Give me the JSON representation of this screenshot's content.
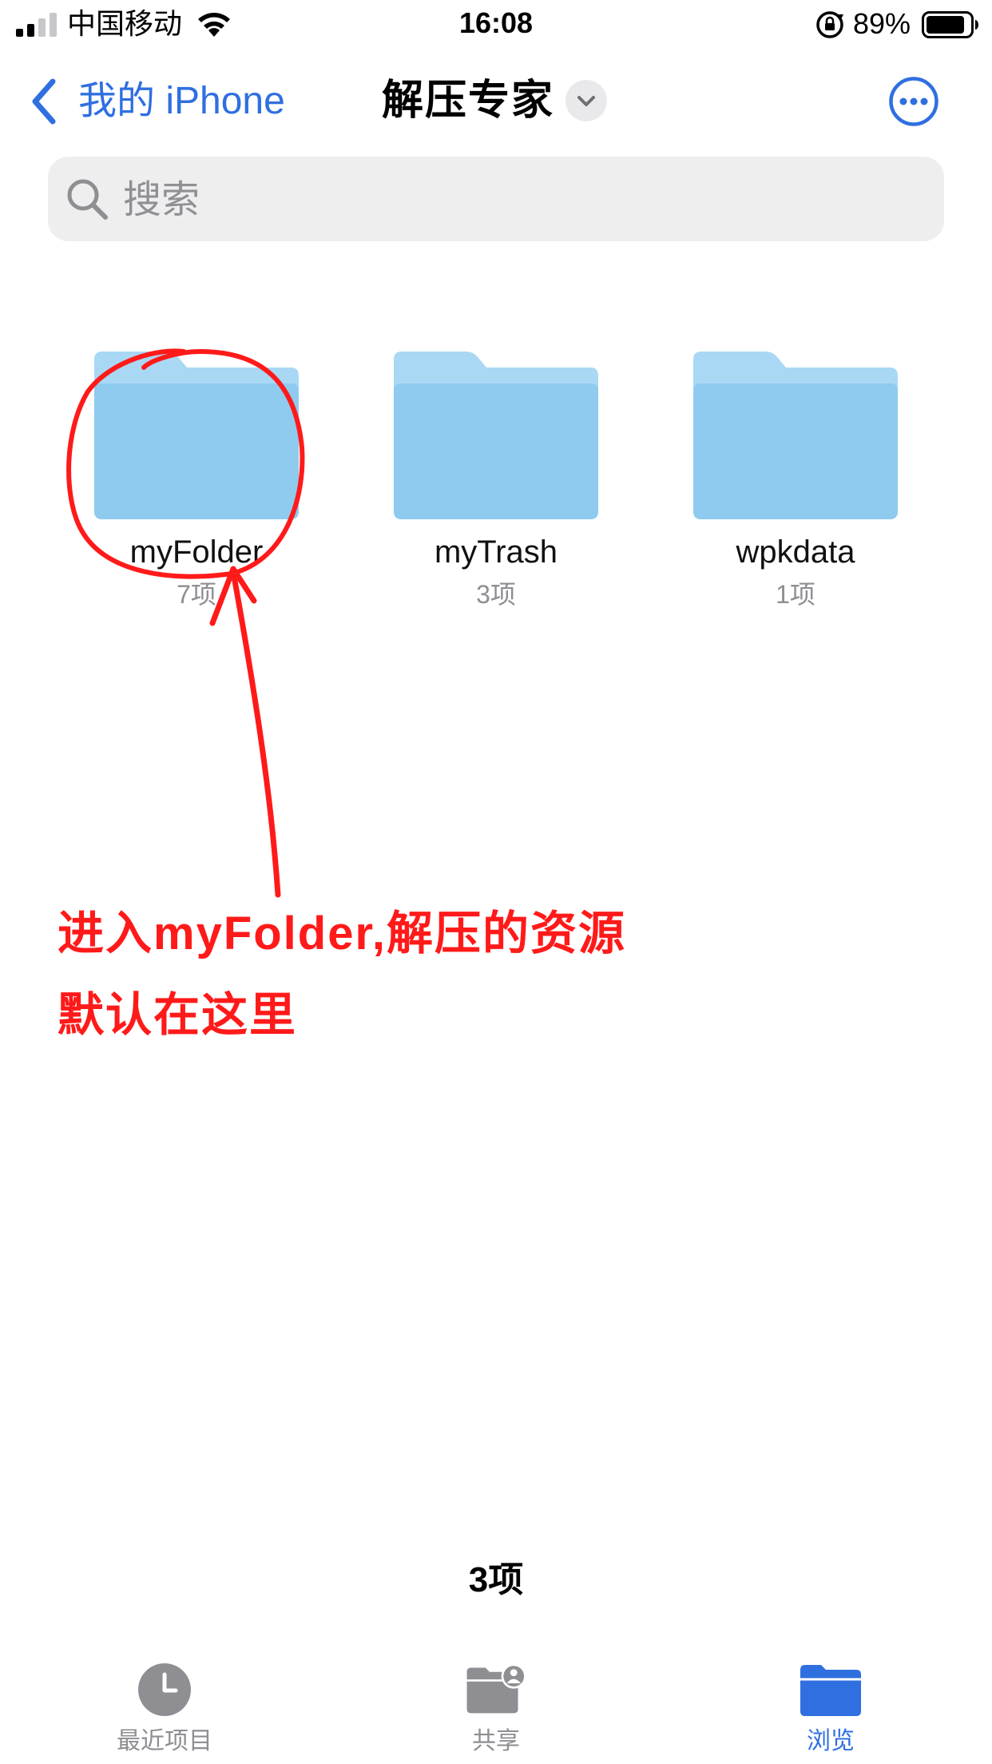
{
  "status_bar": {
    "carrier": "中国移动",
    "time": "16:08",
    "battery_percent": "89%",
    "signal_bars": 2,
    "battery_level": 0.89
  },
  "nav": {
    "back_label": "我的 iPhone",
    "title": "解压专家"
  },
  "search": {
    "placeholder": "搜索",
    "value": ""
  },
  "folders": [
    {
      "name": "myFolder",
      "count": "7项"
    },
    {
      "name": "myTrash",
      "count": "3项"
    },
    {
      "name": "wpkdata",
      "count": "1项"
    }
  ],
  "annotation": {
    "line1": "进入myFolder,解压的资源",
    "line2": "默认在这里",
    "color": "#ff1a1a"
  },
  "footer": {
    "item_count": "3项"
  },
  "tabs": [
    {
      "label": "最近项目",
      "icon": "clock-icon",
      "active": false
    },
    {
      "label": "共享",
      "icon": "shared-folder-icon",
      "active": false
    },
    {
      "label": "浏览",
      "icon": "folder-icon",
      "active": true
    }
  ],
  "colors": {
    "accent": "#2f6fe0",
    "folder_light": "#a9d8f5",
    "folder_body": "#8ecbef",
    "inactive": "#8e8e93"
  }
}
